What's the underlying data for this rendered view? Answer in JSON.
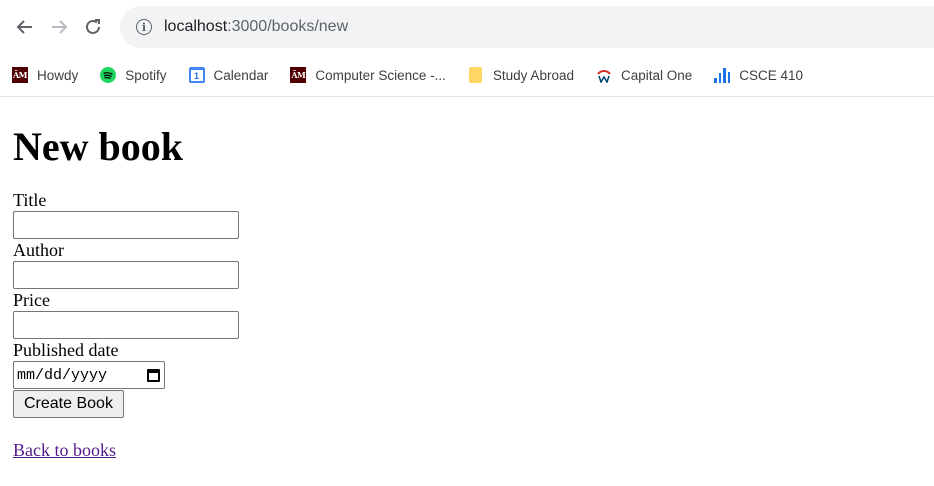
{
  "browser": {
    "url_host": "localhost",
    "url_path": ":3000/books/new",
    "bookmarks": [
      {
        "label": "Howdy",
        "icon": "tamu-logo-icon"
      },
      {
        "label": "Spotify",
        "icon": "spotify-icon"
      },
      {
        "label": "Calendar",
        "icon": "calendar-icon"
      },
      {
        "label": "Computer Science -...",
        "icon": "tamu-logo-icon"
      },
      {
        "label": "Study Abroad",
        "icon": "folder-icon"
      },
      {
        "label": "Capital One",
        "icon": "capital-one-icon"
      },
      {
        "label": "CSCE 410",
        "icon": "bar-chart-icon"
      }
    ],
    "calendar_icon_text": "1",
    "tamu_icon_text": "ĀM"
  },
  "page": {
    "title": "New book",
    "fields": {
      "title_label": "Title",
      "author_label": "Author",
      "price_label": "Price",
      "published_date_label": "Published date",
      "date_placeholder": "mm/dd/yyyy"
    },
    "submit_label": "Create Book",
    "back_link": "Back to books"
  }
}
